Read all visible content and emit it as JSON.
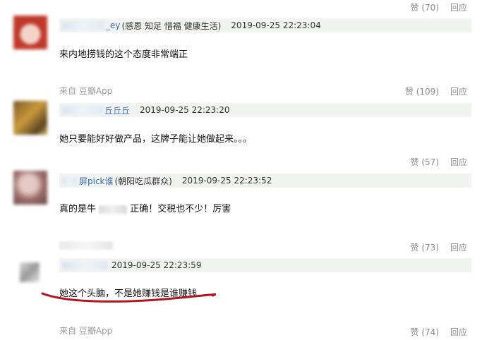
{
  "comments": [
    {
      "like_label": "赞 (70)",
      "reply_label": "回应",
      "username_suffix": "_ey",
      "identity": "(感恩 知足 惜福 健康生活)",
      "time": "2019-09-25 22:23:04",
      "text": "来内地捞钱的这个态度非常端正",
      "source_label": "来自 豆瓣App"
    },
    {
      "like_label": "赞 (109)",
      "reply_label": "回应",
      "username_suffix": "丘丘丘",
      "identity": "",
      "time": "2019-09-25 22:23:20",
      "text": "她只要能好好做产品，这牌子能让她做起来。。。"
    },
    {
      "like_label": "赞 (57)",
      "reply_label": "回应",
      "username_suffix": "屏pick谁",
      "identity": "(朝阳吃瓜群众)",
      "time": "2019-09-25 22:23:52",
      "text_before": "真的是牛",
      "text_after": "正确！交税也不少！厉害"
    },
    {
      "like_label": "赞 (73)",
      "reply_label": "回应",
      "username_suffix": "",
      "identity": "",
      "time": "2019-09-25 22:23:59",
      "text": "她这个头脑，不是她赚钱是谁赚钱",
      "source_label": "来自 豆瓣App"
    },
    {
      "like_label": "赞 (74)",
      "reply_label": "回应"
    }
  ],
  "colors": {
    "username_link": "#3a6bb0",
    "meta_bar_bg": "#f1f3f1",
    "action_text": "#8a8a8a",
    "underline_red": "#b5121b"
  }
}
